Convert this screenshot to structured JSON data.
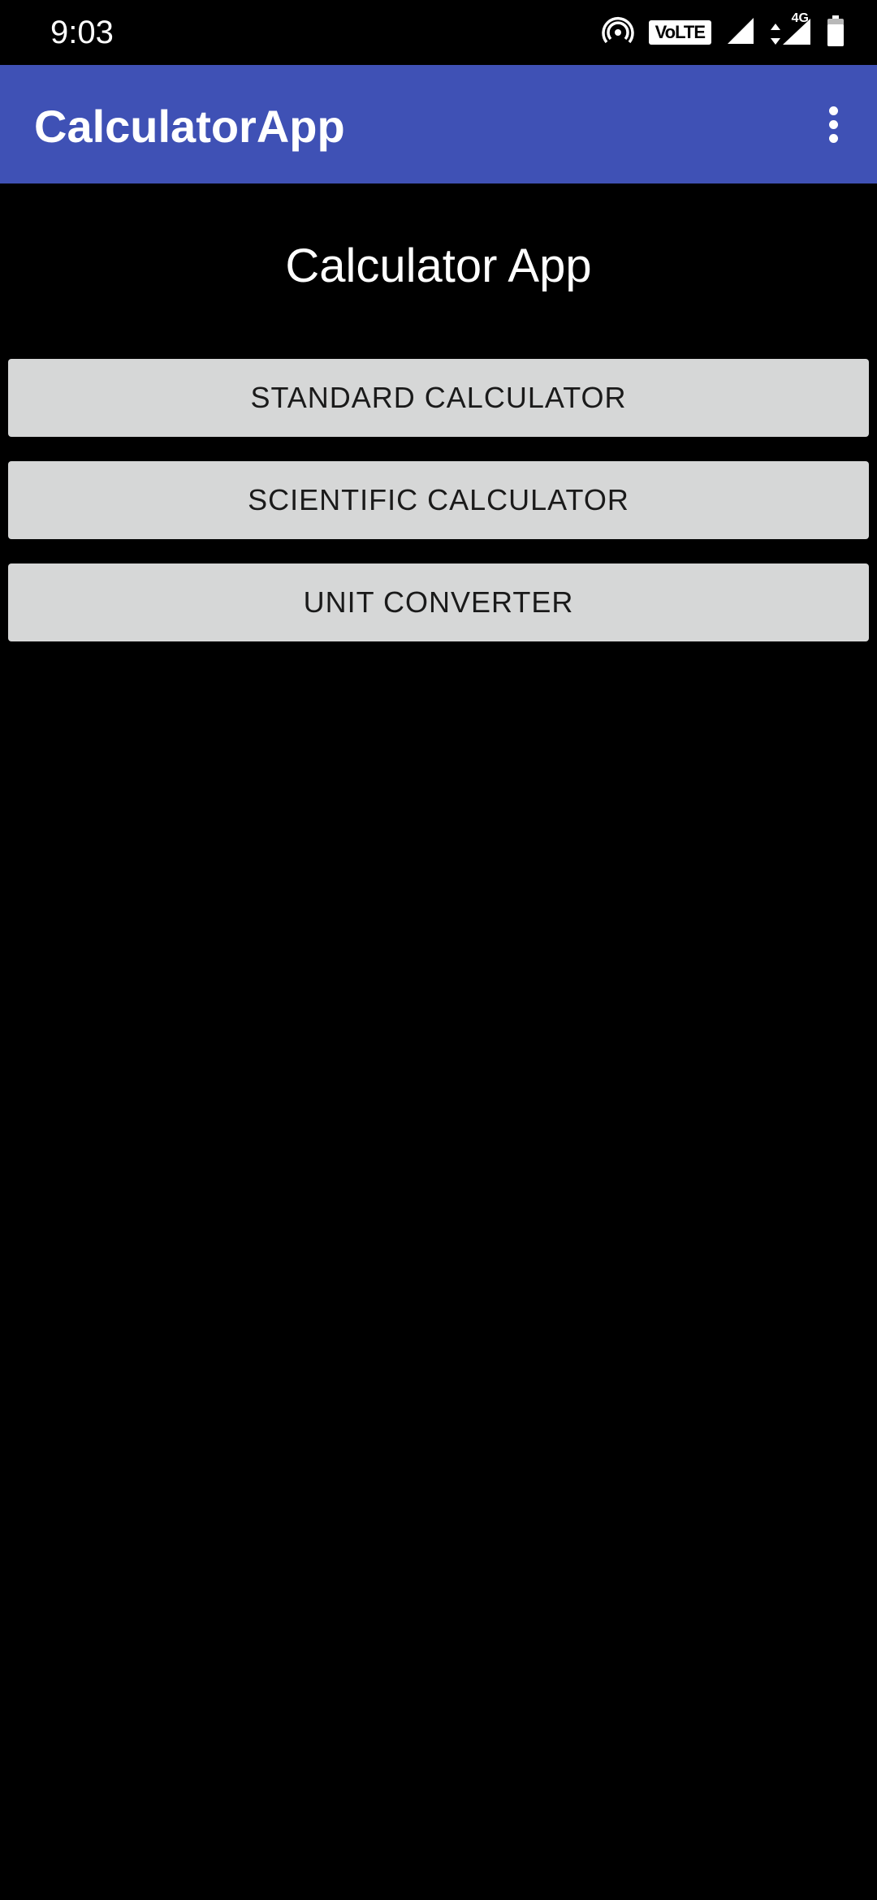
{
  "status_bar": {
    "time": "9:03",
    "volte_label": "VoLTE",
    "network_type": "4G",
    "icons": [
      "hotspot-icon",
      "volte-icon",
      "signal-icon",
      "data-arrows-icon",
      "signal-4g-icon",
      "battery-icon"
    ]
  },
  "app_bar": {
    "title": "CalculatorApp",
    "background_color": "#3F51B5",
    "overflow_icon": "more-vert-icon"
  },
  "main": {
    "heading": "Calculator App",
    "buttons": [
      {
        "label": "STANDARD CALCULATOR"
      },
      {
        "label": "SCIENTIFIC CALCULATOR"
      },
      {
        "label": "UNIT CONVERTER"
      }
    ],
    "button_color": "#D6D7D7"
  }
}
